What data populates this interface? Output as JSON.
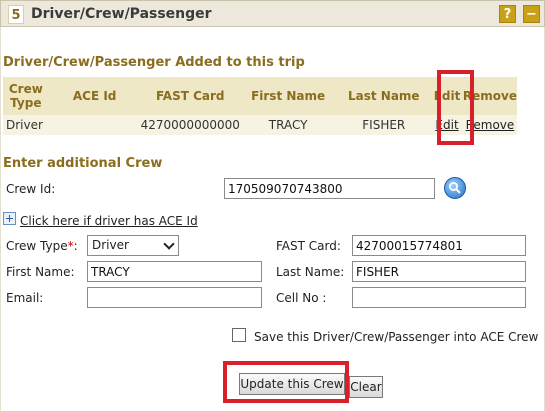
{
  "header": {
    "step_number": "5",
    "title": "Driver/Crew/Passenger",
    "help_label": "?",
    "collapse_label": "−"
  },
  "added_section": {
    "title": "Driver/Crew/Passenger Added to this trip",
    "columns": [
      "Crew Type",
      "ACE Id",
      "FAST Card",
      "First Name",
      "Last Name",
      "Edit",
      "Remove"
    ],
    "rows": [
      {
        "crew_type": "Driver",
        "ace_id": "",
        "fast_card": "4270000000000",
        "first_name": "TRACY",
        "last_name": "FISHER",
        "edit": "Edit",
        "remove": "Remove"
      }
    ]
  },
  "additional_section": {
    "title": "Enter additional Crew",
    "crew_id_label": "Crew Id:",
    "crew_id_value": "170509070743800",
    "search_icon": "search-icon",
    "ace_link": "Click here if driver has ACE Id",
    "crew_type_label": "Crew Type",
    "required_marker": "*",
    "crew_type_colon": ":",
    "crew_type_value": "Driver",
    "fast_card_label": "FAST Card:",
    "fast_card_value": "42700015774801",
    "first_name_label": "First Name:",
    "first_name_value": "TRACY",
    "last_name_label": "Last Name:",
    "last_name_value": "FISHER",
    "email_label": "Email:",
    "email_value": "",
    "cell_label": "Cell No :",
    "cell_value": "",
    "save_checkbox_label": "Save this Driver/Crew/Passenger into ACE Crew",
    "save_checked": false
  },
  "actions": {
    "update_label": "Update this Crew",
    "clear_label": "Clear"
  },
  "colors": {
    "accent": "#8a6d1e",
    "header_bg": "#ece9dc",
    "highlight": "#d8202a"
  }
}
